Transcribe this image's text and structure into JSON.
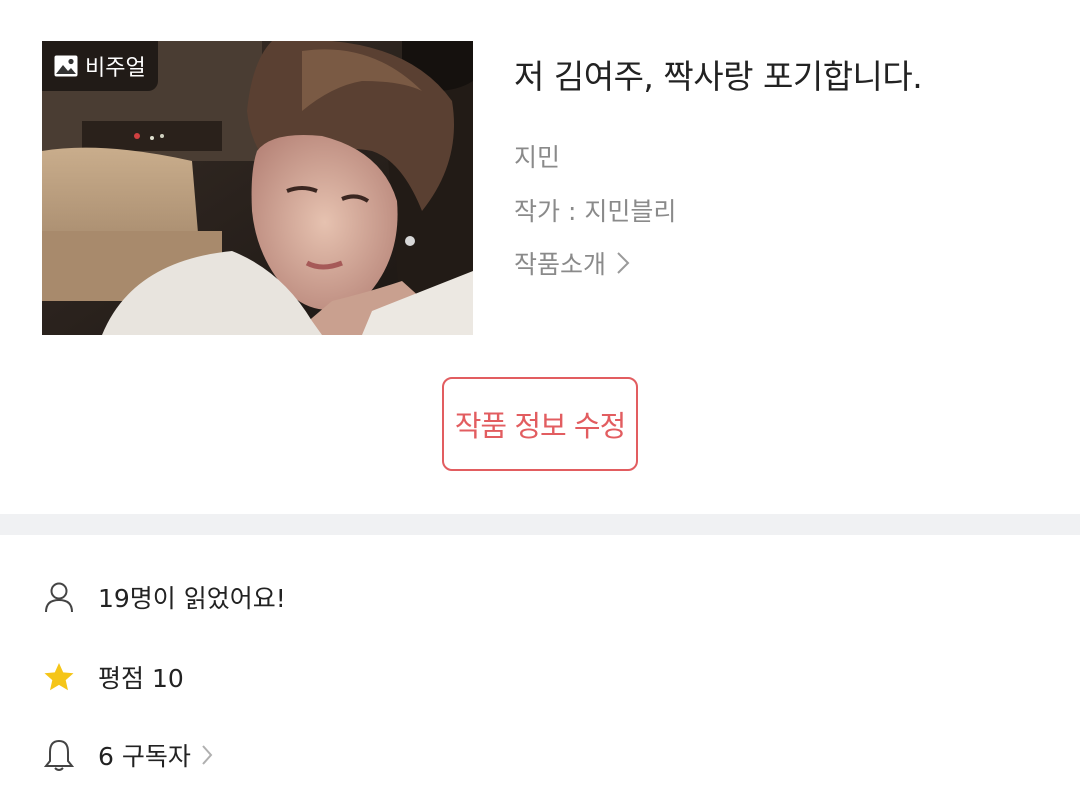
{
  "work": {
    "badge_label": "비주얼",
    "title": "저 김여주, 짝사랑 포기합니다.",
    "genre": "지민",
    "author": "작가 : 지민블리",
    "intro_label": "작품소개"
  },
  "actions": {
    "edit_label": "작품 정보 수정"
  },
  "stats": {
    "readers": "19명이 읽었어요!",
    "rating": "평점 10",
    "subscribers": "6 구독자"
  },
  "colors": {
    "accent": "#e25d60",
    "divider": "#f0f1f3",
    "muted_text": "#8a8a8a",
    "star": "#f5c518"
  },
  "icons": {
    "badge": "image-icon",
    "intro": "chevron-right-icon",
    "readers": "person-icon",
    "rating": "star-icon",
    "subscribers": "bell-icon"
  }
}
